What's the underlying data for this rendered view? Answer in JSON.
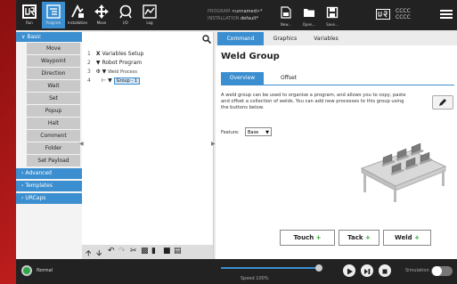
{
  "topbar": {
    "buttons": [
      {
        "label": "Run",
        "icon": "ur-logo-icon"
      },
      {
        "label": "Program",
        "icon": "program-icon"
      },
      {
        "label": "Installation",
        "icon": "installation-icon"
      },
      {
        "label": "Move",
        "icon": "move-icon"
      },
      {
        "label": "I/O",
        "icon": "io-icon"
      },
      {
        "label": "Log",
        "icon": "log-icon"
      }
    ],
    "program_label": "PROGRAM",
    "program_value": "<unnamed>*",
    "installation_label": "INSTALLATION",
    "installation_value": "default*",
    "file_buttons": [
      {
        "label": "New...",
        "icon": "new-file-icon"
      },
      {
        "label": "Open...",
        "icon": "open-folder-icon"
      },
      {
        "label": "Save...",
        "icon": "save-icon"
      }
    ],
    "robot_line1": "CCCC",
    "robot_line2": "CCCC"
  },
  "sidebar": {
    "basic_label": "Basic",
    "items": [
      "Move",
      "Waypoint",
      "Direction",
      "Wait",
      "Set",
      "Popup",
      "Halt",
      "Comment",
      "Folder",
      "Set Payload"
    ],
    "categories": [
      "Advanced",
      "Templates",
      "URCaps"
    ]
  },
  "tree": {
    "lines": [
      {
        "num": "1",
        "text": "Variables Setup"
      },
      {
        "num": "2",
        "text": "Robot Program"
      },
      {
        "num": "3",
        "text": "Weld Process"
      },
      {
        "num": "4",
        "text": "Group - 1"
      }
    ]
  },
  "right": {
    "tabs": [
      "Command",
      "Graphics",
      "Variables"
    ],
    "title": "Weld Group",
    "subtabs": [
      "Overview",
      "Offset"
    ],
    "description": "A weld group can be used to organise a program, and allows you to copy, paste and offset a collection of welds. You can add new processes to this group using the buttons below.",
    "feature_label": "Feature:",
    "feature_value": "Base",
    "buttons": [
      "Touch",
      "Tack",
      "Weld"
    ],
    "plus": "+"
  },
  "bottombar": {
    "status": "Normal",
    "speed_label": "Speed 100%",
    "speed_fraction": 1.0,
    "simulation_label": "Simulation"
  },
  "colors": {
    "accent": "#3b8fd0",
    "status_green": "#2fa84a",
    "plus_green": "#2aa22a"
  }
}
